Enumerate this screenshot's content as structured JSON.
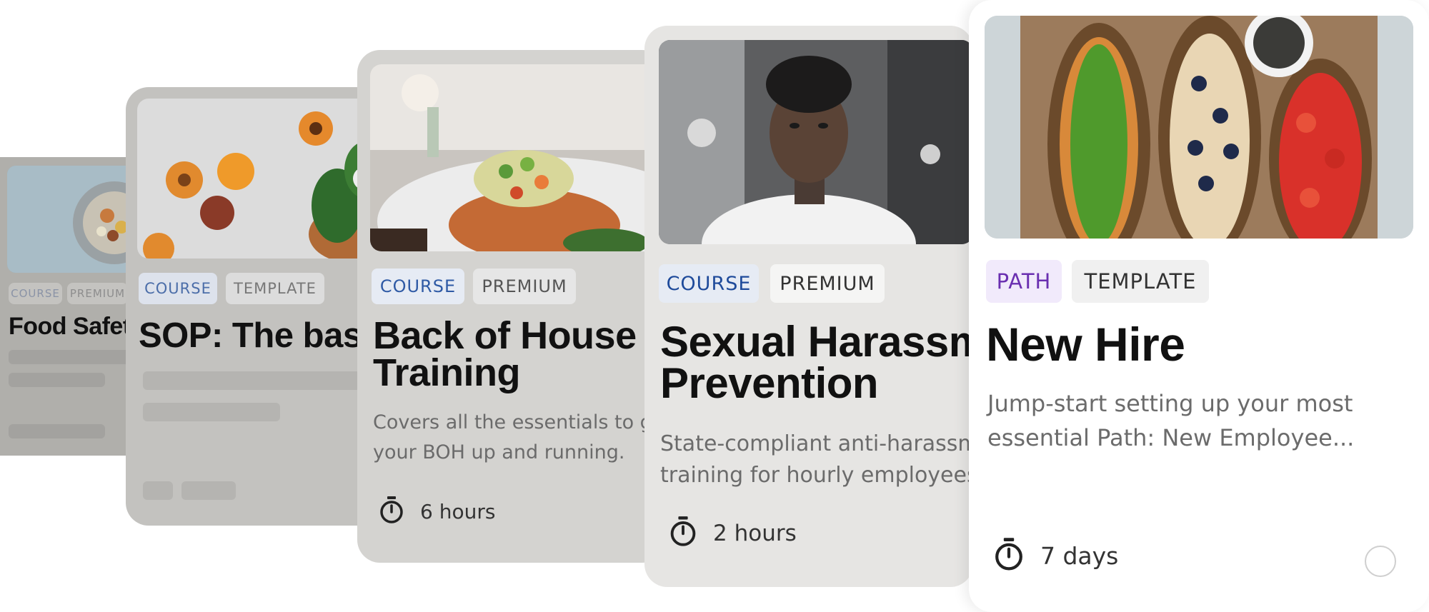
{
  "cards": [
    {
      "tags": [
        "COURSE",
        "PREMIUM"
      ],
      "title": "Food Safety"
    },
    {
      "tags": [
        "COURSE",
        "TEMPLATE"
      ],
      "title": "SOP: The basics"
    },
    {
      "tags": [
        "COURSE",
        "PREMIUM"
      ],
      "title_lines": [
        "Back of House",
        "Training"
      ],
      "desc_lines": [
        "Covers all the essentials to get",
        "your BOH up and running."
      ],
      "duration": "6 hours"
    },
    {
      "tags": [
        "COURSE",
        "PREMIUM"
      ],
      "title_lines": [
        "Sexual Harassment",
        "Prevention"
      ],
      "desc_lines": [
        "State-compliant anti-harassment",
        "training for hourly employees"
      ],
      "duration": "2 hours"
    },
    {
      "tags": [
        "PATH",
        "TEMPLATE"
      ],
      "title": "New Hire",
      "desc_lines": [
        "Jump-start setting up your most",
        "essential Path: New Employee..."
      ],
      "duration": "7 days"
    }
  ],
  "icons": {
    "duration": "stopwatch-icon",
    "select": "radio-circle-icon"
  },
  "colors": {
    "course_tag_text": "#2451a6",
    "course_tag_bg": "#e8eefb",
    "path_tag_text": "#6a2fb0",
    "path_tag_bg": "#f1eafb",
    "neutral_tag_bg": "#f0f0f0"
  }
}
